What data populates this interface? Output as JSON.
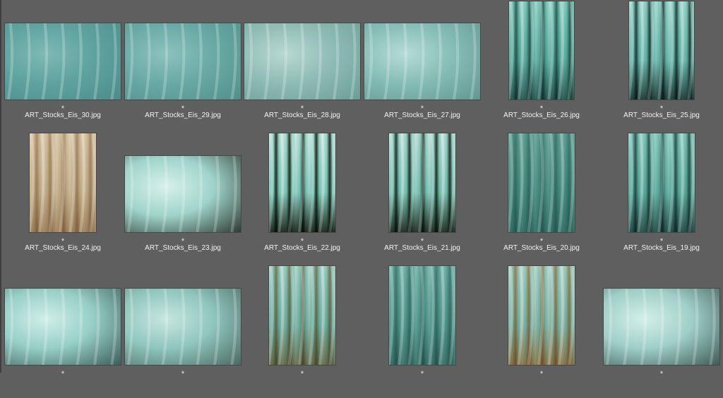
{
  "grid": {
    "rows": [
      [
        {
          "file": "ART_Stocks_Eis_30.jpg",
          "rating": "*",
          "orientation": "landscape",
          "palette": [
            "#5fa3a0",
            "#4c8c8a",
            "#7fb9b4"
          ],
          "icon": "ice-photo"
        },
        {
          "file": "ART_Stocks_Eis_29.jpg",
          "rating": "*",
          "orientation": "landscape",
          "palette": [
            "#6aaaa6",
            "#4f908d",
            "#8cc2bd"
          ],
          "icon": "ice-photo"
        },
        {
          "file": "ART_Stocks_Eis_28.jpg",
          "rating": "*",
          "orientation": "landscape",
          "palette": [
            "#8fbcb5",
            "#6a9d97",
            "#b9d8d2"
          ],
          "icon": "ice-photo"
        },
        {
          "file": "ART_Stocks_Eis_27.jpg",
          "rating": "*",
          "orientation": "landscape",
          "palette": [
            "#86bdb6",
            "#5f9791",
            "#b6dcd6"
          ],
          "icon": "ice-photo"
        },
        {
          "file": "ART_Stocks_Eis_26.jpg",
          "rating": "*",
          "orientation": "portrait",
          "palette": [
            "#8cc8c0",
            "#3f6b66",
            "#c9ece6"
          ],
          "icon": "ice-photo"
        },
        {
          "file": "ART_Stocks_Eis_25.jpg",
          "rating": "*",
          "orientation": "portrait",
          "palette": [
            "#98d0c8",
            "#2f4a47",
            "#d2eee9"
          ],
          "icon": "ice-photo"
        }
      ],
      [
        {
          "file": "ART_Stocks_Eis_24.jpg",
          "rating": "*",
          "orientation": "portrait",
          "palette": [
            "#d9ccb4",
            "#b39a7a",
            "#efe6d4"
          ],
          "icon": "ice-photo"
        },
        {
          "file": "ART_Stocks_Eis_23.jpg",
          "rating": "*",
          "orientation": "landscape",
          "palette": [
            "#9fd4cb",
            "#2e3b31",
            "#d8f0ea"
          ],
          "icon": "ice-photo"
        },
        {
          "file": "ART_Stocks_Eis_22.jpg",
          "rating": "*",
          "orientation": "portrait",
          "palette": [
            "#a8dcd3",
            "#2b3327",
            "#e6f3f0"
          ],
          "icon": "ice-photo"
        },
        {
          "file": "ART_Stocks_Eis_21.jpg",
          "rating": "*",
          "orientation": "portrait",
          "palette": [
            "#a3d8cf",
            "#2f3a2d",
            "#e3f1ee"
          ],
          "icon": "ice-photo"
        },
        {
          "file": "ART_Stocks_Eis_20.jpg",
          "rating": "*",
          "orientation": "portrait",
          "palette": [
            "#7fb6ae",
            "#5d938c",
            "#a9d1ca"
          ],
          "icon": "ice-photo"
        },
        {
          "file": "ART_Stocks_Eis_19.jpg",
          "rating": "*",
          "orientation": "portrait",
          "palette": [
            "#8fc9c0",
            "#3c5f5b",
            "#c6e8e2"
          ],
          "icon": "ice-photo"
        }
      ],
      [
        {
          "file": "",
          "rating": "*",
          "orientation": "landscape",
          "palette": [
            "#96cfc6",
            "#3d5e5a",
            "#d1eee9"
          ],
          "icon": "ice-photo"
        },
        {
          "file": "",
          "rating": "*",
          "orientation": "landscape",
          "palette": [
            "#8fc6bd",
            "#4b6a62",
            "#c8e6e0"
          ],
          "icon": "ice-photo"
        },
        {
          "file": "",
          "rating": "*",
          "orientation": "portrait",
          "palette": [
            "#a0ccc3",
            "#8c8160",
            "#d6ece7"
          ],
          "icon": "ice-photo"
        },
        {
          "file": "",
          "rating": "*",
          "orientation": "portrait",
          "palette": [
            "#86bcb5",
            "#5e8f89",
            "#b8dcd6"
          ],
          "icon": "ice-photo"
        },
        {
          "file": "",
          "rating": "*",
          "orientation": "portrait",
          "palette": [
            "#a9cfc6",
            "#b08a5a",
            "#d9ece7"
          ],
          "icon": "ice-photo"
        },
        {
          "file": "",
          "rating": "*",
          "orientation": "landscape",
          "palette": [
            "#9fcfc7",
            "#3f5a56",
            "#d4efea"
          ],
          "icon": "ice-photo"
        }
      ]
    ]
  }
}
